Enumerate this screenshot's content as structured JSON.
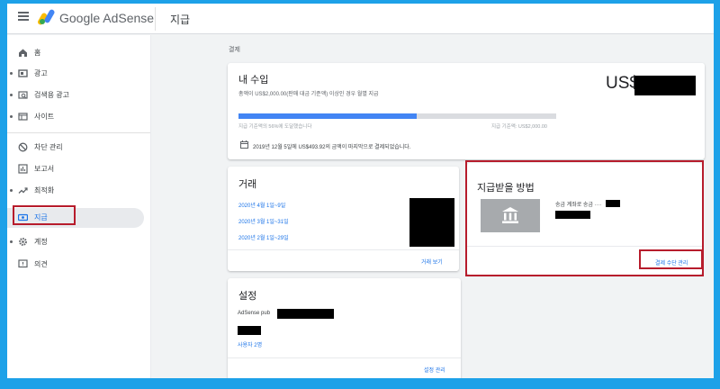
{
  "header": {
    "brand": "Google AdSense",
    "page_title": "지급"
  },
  "sidebar": {
    "items": [
      {
        "label": "홈",
        "icon": "home-icon"
      },
      {
        "label": "광고",
        "icon": "ads-icon"
      },
      {
        "label": "검색용 광고",
        "icon": "search-ads-icon"
      },
      {
        "label": "사이트",
        "icon": "sites-icon"
      },
      {
        "label": "차단 관리",
        "icon": "block-icon"
      },
      {
        "label": "보고서",
        "icon": "reports-icon"
      },
      {
        "label": "최적화",
        "icon": "optimization-icon"
      },
      {
        "label": "지급",
        "icon": "payments-icon",
        "active": true
      },
      {
        "label": "계정",
        "icon": "gear-icon"
      },
      {
        "label": "의견",
        "icon": "feedback-icon"
      }
    ]
  },
  "main": {
    "breadcrumb": "결제",
    "earnings": {
      "title": "내 수입",
      "subtitle": "총액이 US$2,000.00(판매 대금 기준액) 이상인 경우 월별 지급",
      "amount_prefix": "US$",
      "progress_fraction": 0.56,
      "progress_left": "지급 기준액의 56%에 도달했습니다",
      "progress_right": "지급 기준액: US$2,000.00",
      "last_payment": "2019년 12월 5일에 US$493.92의 금액이 마지막으로 결제되었습니다."
    },
    "transactions": {
      "title": "거래",
      "items": [
        "2020년 4월 1일~9일",
        "2020년 3월 1일~31일",
        "2020년 2월 1일~29일"
      ],
      "view_label": "거래 보기"
    },
    "payment_method": {
      "title": "지급받을 방법",
      "account": "송금 계좌로 송금 ····",
      "manage_label": "결제 수단 관리"
    },
    "settings": {
      "title": "설정",
      "pub_label": "AdSense pub",
      "users_label": "사용자 2명",
      "manage_label": "설정 관리"
    }
  },
  "colors": {
    "accent": "#1a73e8",
    "highlight": "#b71c2c",
    "frame": "#1da1e8"
  }
}
